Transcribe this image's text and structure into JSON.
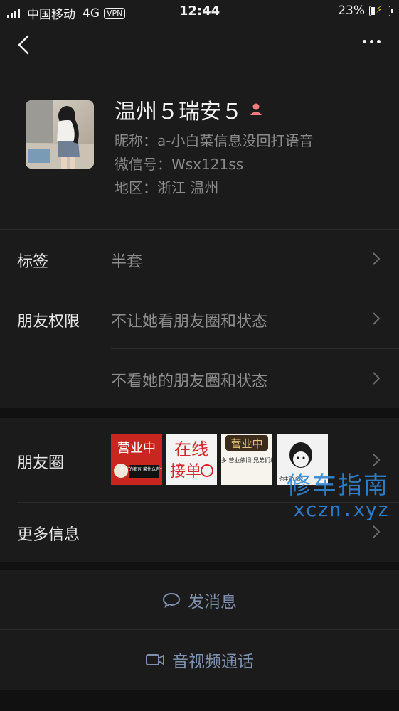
{
  "status_bar": {
    "carrier": "中国移动",
    "network": "4G",
    "vpn": "VPN",
    "time": "12:44",
    "battery_percent": "23%",
    "battery_level": 0.23,
    "charging_icon": "bolt-icon"
  },
  "nav": {
    "back_icon": "chevron-left-icon",
    "more_icon": "more-dots-icon"
  },
  "profile": {
    "name": "温州５瑞安５",
    "gender_icon": "female-icon",
    "nickname": "昵称：a-小白菜信息没回打语音",
    "wechat_id": "微信号：Wsx121ss",
    "region": "地区：浙江 温州"
  },
  "rows": {
    "tags_label": "标签",
    "tags_value": "半套",
    "permissions_label": "朋友权限",
    "permission_1": "不让她看朋友圈和状态",
    "permission_2": "不看她的朋友圈和状态",
    "moments_label": "朋友圈",
    "more_info_label": "更多信息"
  },
  "moments_thumbs": [
    {
      "text": "营业中",
      "caption": "店有的都有 菜什么有什么"
    },
    {
      "text": "在线",
      "text2": "接单"
    },
    {
      "text": "营业中",
      "caption": "新款特别多 营业依旧 兄弟们组团来吧!"
    },
    {
      "text": "",
      "caption": "你主动 吗?"
    }
  ],
  "actions": {
    "message": "发消息",
    "call": "音视频通话"
  },
  "watermark": {
    "cn": "修车指南",
    "en": "xczn.xyz"
  },
  "colors": {
    "background": "#111111",
    "panel": "#1b1b1b",
    "action_text": "#7f90ad",
    "watermark": "#2f86d6",
    "gender_icon": "#f07c7c"
  }
}
